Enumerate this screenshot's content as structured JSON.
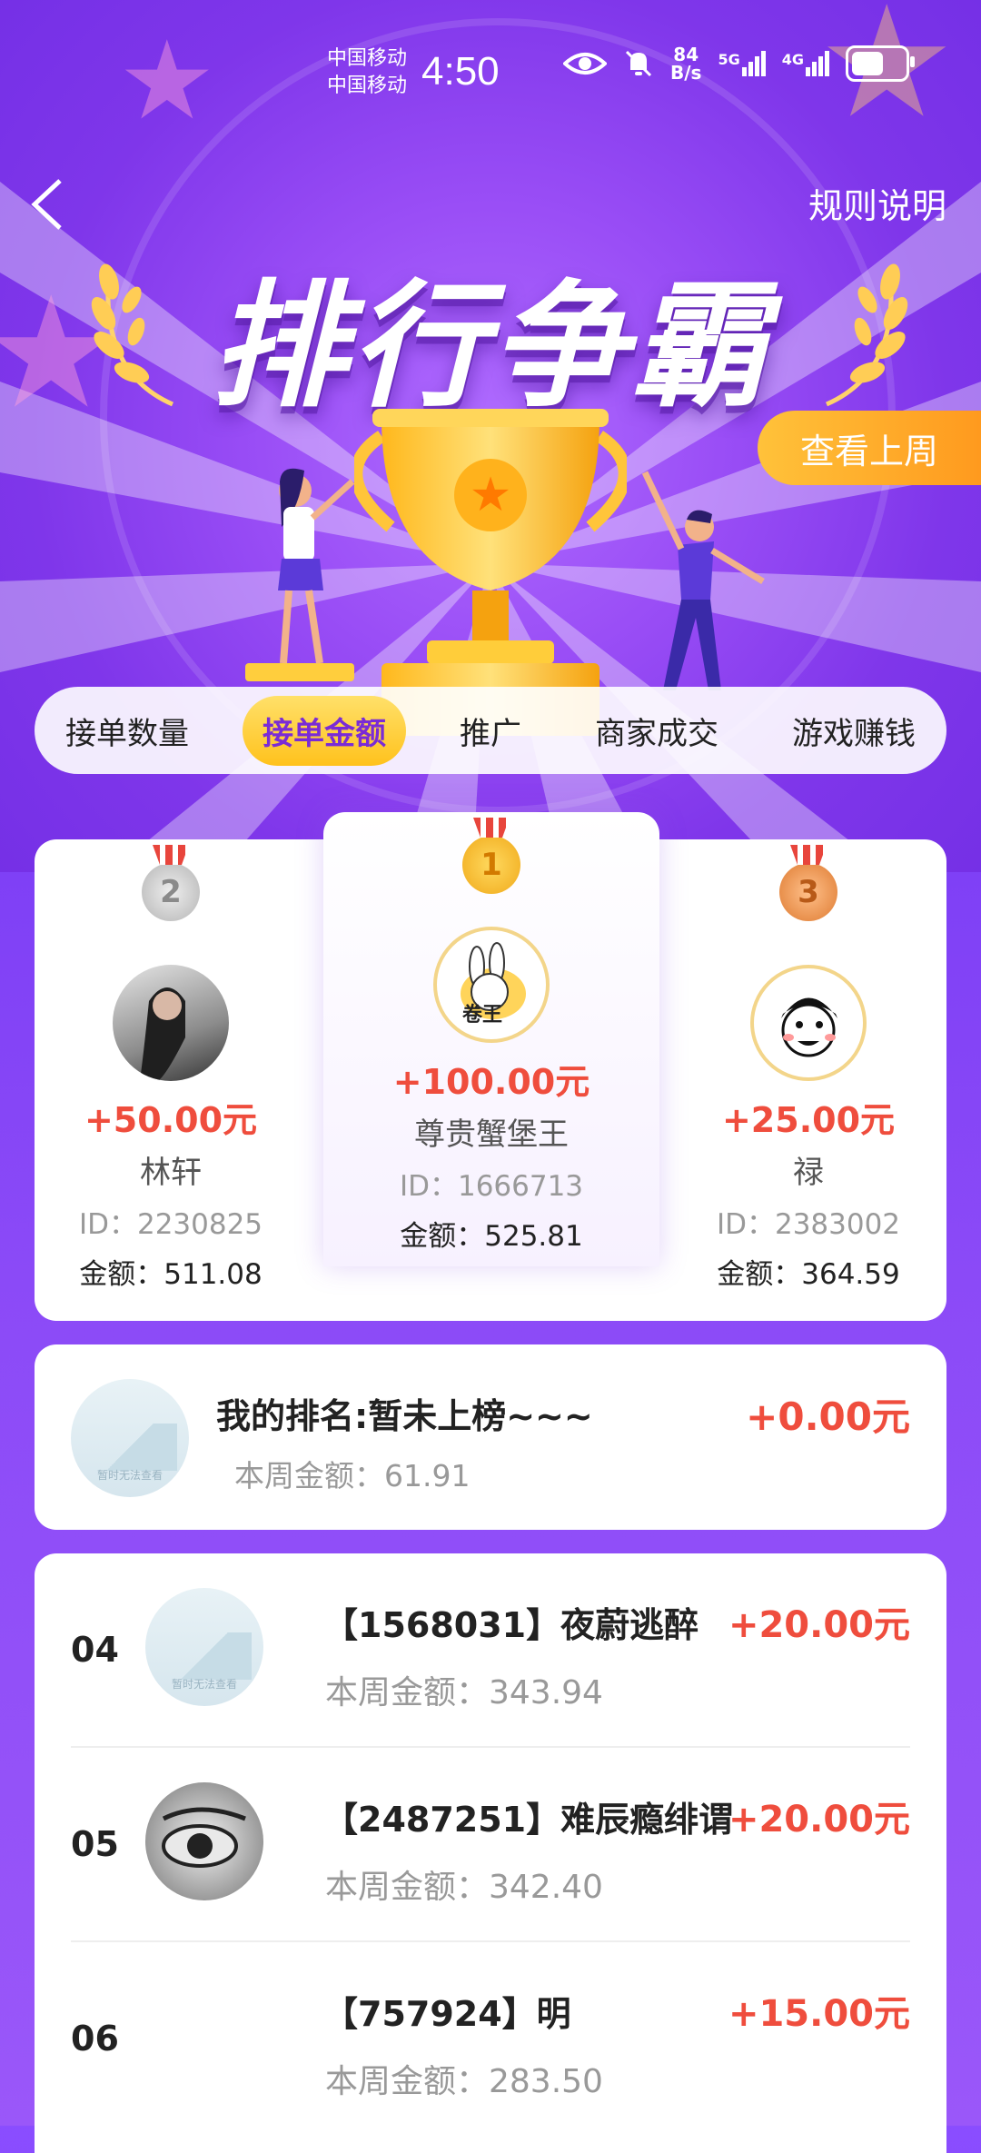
{
  "status_bar": {
    "carrier1": "中国移动",
    "carrier2": "中国移动",
    "time": "4:50",
    "net_speed_value": "84",
    "net_speed_unit": "B/s",
    "signal1": "5G",
    "signal2": "4G"
  },
  "header": {
    "back_icon": "chevron-left-icon",
    "rules_label": "规则说明",
    "banner_title": "排行争霸",
    "last_week_label": "查看上周"
  },
  "tabs": [
    {
      "label": "接单数量",
      "active": false
    },
    {
      "label": "接单金额",
      "active": true
    },
    {
      "label": "推广",
      "active": false
    },
    {
      "label": "商家成交",
      "active": false
    },
    {
      "label": "游戏赚钱",
      "active": false
    }
  ],
  "podium": {
    "first": {
      "medal": "1",
      "amount": "+100.00元",
      "name": "尊贵蟹堡王",
      "id": "ID：1666713",
      "money": "金额：525.81"
    },
    "second": {
      "medal": "2",
      "amount": "+50.00元",
      "name": "林轩",
      "id": "ID：2230825",
      "money": "金额：511.08"
    },
    "third": {
      "medal": "3",
      "amount": "+25.00元",
      "name": "禄",
      "id": "ID：2383002",
      "money": "金额：364.59"
    }
  },
  "my_rank": {
    "title": "我的排名:暂未上榜~~~",
    "week_amount": "本周金额：61.91",
    "reward": "+0.00元",
    "avatar_placeholder": "暂时无法查看"
  },
  "list": [
    {
      "rank": "04",
      "title": "【1568031】夜蔚逃醉",
      "week_amount": "本周金额：343.94",
      "reward": "+20.00元",
      "avatar_placeholder": "暂时无法查看"
    },
    {
      "rank": "05",
      "title": "【2487251】难辰瘾绯谓",
      "week_amount": "本周金额：342.40",
      "reward": "+20.00元"
    },
    {
      "rank": "06",
      "title": "【757924】明",
      "week_amount": "本周金额：283.50",
      "reward": "+15.00元"
    }
  ],
  "colors": {
    "accent_red": "#ef4d3d",
    "tab_active": "#ffc21d",
    "bg_purple": "#7b3df5"
  }
}
